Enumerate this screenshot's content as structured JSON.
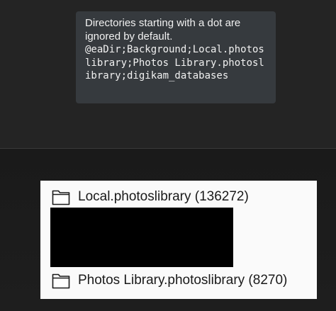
{
  "tooltip": {
    "description": "Directories starting with a dot are ignored by default.",
    "ignored_list": "@eaDir;Background;Local.photoslibrary;Photos Library.photoslibrary;digikam_databases"
  },
  "folders": [
    {
      "label": "Local.photoslibrary (136272)",
      "icon": "folder-icon"
    },
    {
      "label": "Photos Library.photoslibrary (8270)",
      "icon": "folder-icon"
    }
  ]
}
